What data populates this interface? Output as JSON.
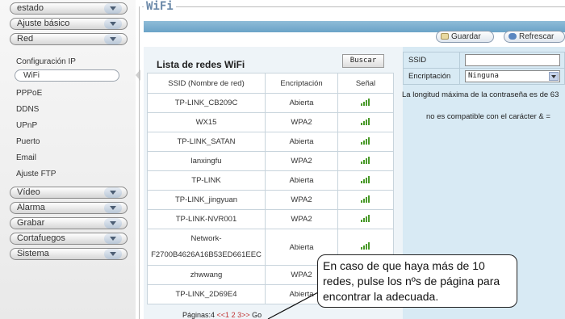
{
  "sidebar": {
    "items": [
      {
        "label": "estado"
      },
      {
        "label": "Ajuste básico"
      },
      {
        "label": "Red"
      },
      {
        "label": "Vídeo"
      },
      {
        "label": "Alarma"
      },
      {
        "label": "Grabar"
      },
      {
        "label": "Cortafuegos"
      },
      {
        "label": "Sistema"
      }
    ],
    "red_sub": [
      "Configuración IP",
      "WiFi",
      "PPPoE",
      "DDNS",
      "UPnP",
      "Puerto",
      "Email",
      "Ajuste FTP"
    ]
  },
  "page": {
    "title": "WiFi",
    "save_label": "Guardar",
    "refresh_label": "Refrescar"
  },
  "wifi_list": {
    "title": "Lista de redes WiFi",
    "search_label": "Buscar",
    "columns": [
      "SSID (Nombre de red)",
      "Encriptación",
      "Señal"
    ],
    "rows": [
      {
        "ssid": "TP-LINK_CB209C",
        "enc": "Abierta"
      },
      {
        "ssid": "WX15",
        "enc": "WPA2"
      },
      {
        "ssid": "TP-LINK_SATAN",
        "enc": "Abierta"
      },
      {
        "ssid": "lanxingfu",
        "enc": "WPA2"
      },
      {
        "ssid": "TP-LINK",
        "enc": "Abierta"
      },
      {
        "ssid": "TP-LINK_jingyuan",
        "enc": "WPA2"
      },
      {
        "ssid": "TP-LINK-NVR001",
        "enc": "WPA2"
      },
      {
        "ssid": "Network-",
        "ssid2": "F2700B4626A16B53ED661EEC",
        "enc": "Abierta"
      },
      {
        "ssid": "zhwwang",
        "enc": "WPA2"
      },
      {
        "ssid": "TP-LINK_2D69E4",
        "enc": "Abierta"
      }
    ],
    "pager_label": "Páginas:4",
    "pager_pages": "<<1 2 3>>",
    "pager_go": "Go"
  },
  "form": {
    "ssid_label": "SSID",
    "ssid_value": "",
    "enc_label": "Encriptación",
    "enc_value": "Ninguna",
    "hint_line1": "La longitud máxima de la contraseña es de 63",
    "hint_line2": "no es compatible con el carácter & ="
  },
  "callout": {
    "line1": "En caso de que haya más de 10",
    "line2": "redes, pulse los nºs de página para",
    "line3": "encontrar la adecuada."
  },
  "colors": {
    "accent": "#6aa3c7",
    "signal": "#4a9a2a",
    "title": "#6a88a8"
  }
}
